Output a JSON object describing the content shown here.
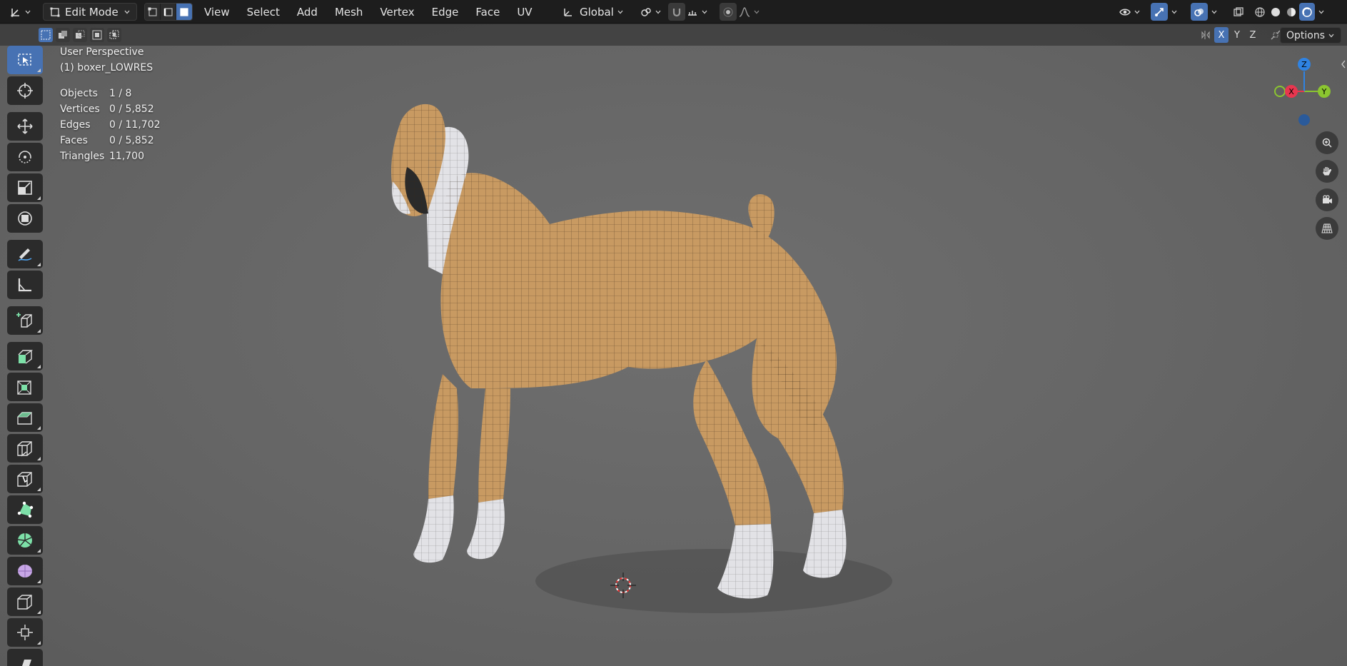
{
  "header": {
    "editor_type_icon": "axes-icon",
    "mode": "Edit Mode",
    "menus": [
      "View",
      "Select",
      "Add",
      "Mesh",
      "Vertex",
      "Edge",
      "Face",
      "UV"
    ],
    "transform_orientation": "Global"
  },
  "subheader": {
    "axes": [
      "X",
      "Y",
      "Z"
    ],
    "options_label": "Options"
  },
  "overlay": {
    "view_name": "User Perspective",
    "object_name": "(1) boxer_LOWRES",
    "stats": [
      {
        "label": "Objects",
        "value": "1 / 8"
      },
      {
        "label": "Vertices",
        "value": "0 / 5,852"
      },
      {
        "label": "Edges",
        "value": "0 / 11,702"
      },
      {
        "label": "Faces",
        "value": "0 / 5,852"
      },
      {
        "label": "Triangles",
        "value": "11,700"
      }
    ]
  },
  "gizmo": {
    "x": "X",
    "y": "Y",
    "z": "Z"
  },
  "colors": {
    "accent": "#4772b3",
    "axis_x": "#e8364f",
    "axis_y": "#8bc530",
    "axis_z": "#2f83e3",
    "fur": "#c89a62",
    "white_fur": "#e2e2e6"
  }
}
